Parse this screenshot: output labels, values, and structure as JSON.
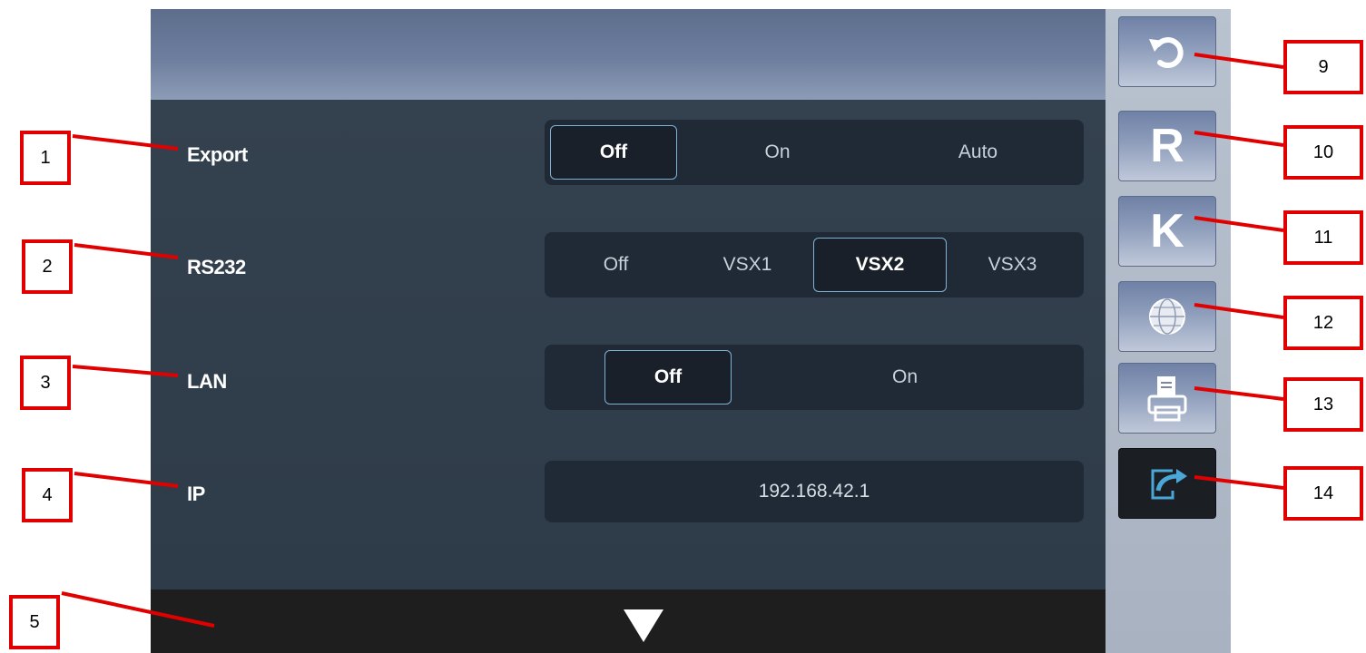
{
  "settings": {
    "export": {
      "label": "Export",
      "options": [
        "Off",
        "On",
        "Auto"
      ],
      "selected": "Off"
    },
    "rs232": {
      "label": "RS232",
      "options": [
        "Off",
        "VSX1",
        "VSX2",
        "VSX3"
      ],
      "selected": "VSX2"
    },
    "lan": {
      "label": "LAN",
      "options": [
        "Off",
        "On"
      ],
      "selected": "Off"
    },
    "ip": {
      "label": "IP",
      "value": "192.168.42.1"
    }
  },
  "sidebar": {
    "undo_icon": "undo-icon",
    "r_label": "R",
    "k_label": "K",
    "globe_icon": "globe-icon",
    "print_icon": "printer-icon",
    "export_icon": "export-icon"
  },
  "bottom_bar": {
    "icon": "down-arrow-icon"
  },
  "callouts": [
    "1",
    "2",
    "3",
    "4",
    "5",
    "9",
    "10",
    "11",
    "12",
    "13",
    "14"
  ],
  "colors": {
    "accent_border": "#7fb3d6",
    "callout_red": "#e00000"
  }
}
